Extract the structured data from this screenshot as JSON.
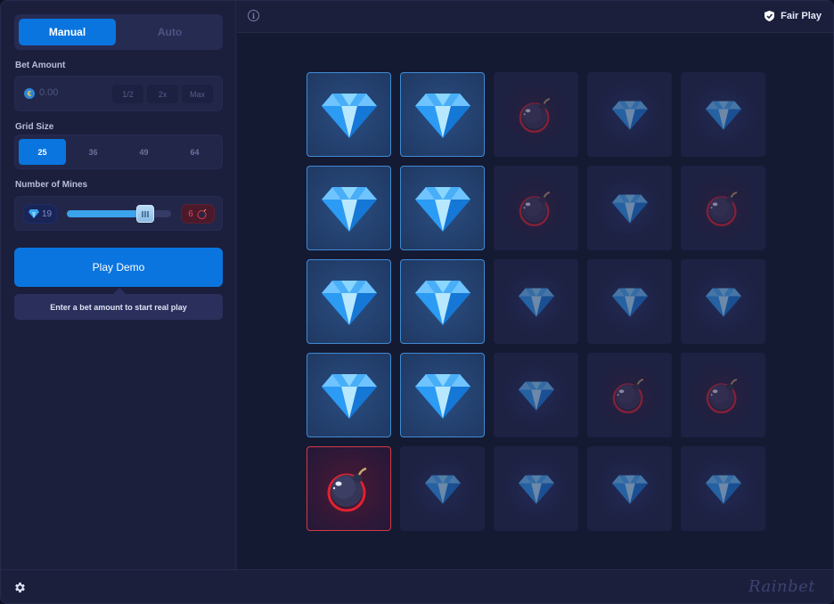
{
  "sidebar": {
    "mode_tabs": [
      {
        "label": "Manual",
        "active": true
      },
      {
        "label": "Auto",
        "active": false
      }
    ],
    "bet_amount": {
      "label": "Bet Amount",
      "currency_icon": "coin-icon",
      "currency_glyph": "€",
      "value": "0.00",
      "buttons": [
        "1/2",
        "2x",
        "Max"
      ]
    },
    "grid_size": {
      "label": "Grid Size",
      "options": [
        "25",
        "36",
        "49",
        "64"
      ],
      "selected": "25"
    },
    "mines": {
      "label": "Number of Mines",
      "gems": "19",
      "mines": "6",
      "slider_fill_fraction": 0.75
    },
    "play_button": "Play Demo",
    "hint": "Enter a bet amount to start real play"
  },
  "topbar": {
    "info_icon": "info-icon",
    "fair_play_label": "Fair Play",
    "fair_play_icon": "shield-check-icon"
  },
  "board": {
    "rows": 5,
    "cols": 5,
    "tiles": [
      [
        "gem-revealed",
        "gem-revealed",
        "bomb-dim",
        "gem-dim",
        "gem-dim"
      ],
      [
        "gem-revealed",
        "gem-revealed",
        "bomb-dim",
        "gem-dim",
        "bomb-dim"
      ],
      [
        "gem-revealed",
        "gem-revealed",
        "gem-dim",
        "gem-dim",
        "gem-dim"
      ],
      [
        "gem-revealed",
        "gem-revealed",
        "gem-dim",
        "bomb-dim",
        "bomb-dim"
      ],
      [
        "bomb-hit",
        "gem-dim",
        "gem-dim",
        "gem-dim",
        "gem-dim"
      ]
    ]
  },
  "footer": {
    "settings_icon": "gear-icon",
    "brand": "Rainbet"
  },
  "colors": {
    "accent": "#0a75df",
    "gem_border": "#3f8ad6",
    "bomb_border": "#d23b49",
    "background": "#151a33"
  }
}
